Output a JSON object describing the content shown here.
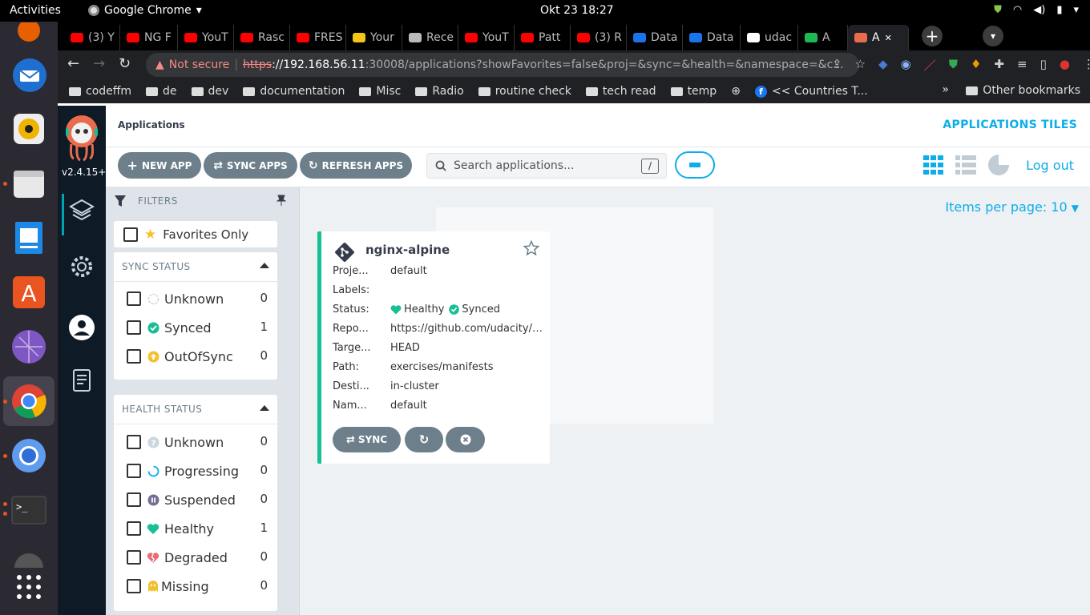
{
  "os": {
    "activities": "Activities",
    "app_name": "Google Chrome",
    "clock": "Okt 23  18:27"
  },
  "browser": {
    "tabs": [
      {
        "label": "(3) Y",
        "color": "#ff0000"
      },
      {
        "label": "NG F",
        "color": "#ff0000"
      },
      {
        "label": "YouT",
        "color": "#ff0000"
      },
      {
        "label": "Rasc",
        "color": "#ff0000"
      },
      {
        "label": "FRES",
        "color": "#ff0000"
      },
      {
        "label": "Your",
        "color": "#f5c518"
      },
      {
        "label": "Rece",
        "color": "#bbbbbb"
      },
      {
        "label": "YouT",
        "color": "#ff0000"
      },
      {
        "label": "Patt",
        "color": "#ff0000"
      },
      {
        "label": "(3) R",
        "color": "#ff0000"
      },
      {
        "label": "Data",
        "color": "#1a73e8"
      },
      {
        "label": "Data",
        "color": "#1a73e8"
      },
      {
        "label": "udac",
        "color": "#ffffff"
      },
      {
        "label": "A",
        "color": "#1db954"
      },
      {
        "label": "A",
        "color": "#e96d4c",
        "active": true
      }
    ],
    "omnibox": {
      "warning": "Not secure",
      "protocol": "https",
      "host": "://192.168.56.11",
      "path": ":30008/applications?showFavorites=false&proj=&sync=&health=&namespace=&c..."
    },
    "bookmarks": [
      "codeffm",
      "de",
      "dev",
      "documentation",
      "Misc",
      "Radio",
      "routine check",
      "tech read",
      "temp"
    ],
    "bookmark_special": "<< Countries T...",
    "other_bookmarks": "Other bookmarks",
    "overflow": "»"
  },
  "argo": {
    "version": "v2.4.15+",
    "breadcrumb": "Applications",
    "page_title": "APPLICATIONS TILES",
    "buttons": {
      "new_app": "NEW APP",
      "sync_apps": "SYNC APPS",
      "refresh_apps": "REFRESH APPS"
    },
    "search_placeholder": "Search applications...",
    "search_shortcut": "/",
    "logout": "Log out",
    "items_per_page": "Items per page: 10",
    "filters": {
      "title": "FILTERS",
      "favorites_only": "Favorites Only",
      "sync_status_title": "SYNC STATUS",
      "sync_status": [
        {
          "label": "Unknown",
          "count": "0"
        },
        {
          "label": "Synced",
          "count": "1"
        },
        {
          "label": "OutOfSync",
          "count": "0"
        }
      ],
      "health_status_title": "HEALTH STATUS",
      "health_status": [
        {
          "label": "Unknown",
          "count": "0"
        },
        {
          "label": "Progressing",
          "count": "0"
        },
        {
          "label": "Suspended",
          "count": "0"
        },
        {
          "label": "Healthy",
          "count": "1"
        },
        {
          "label": "Degraded",
          "count": "0"
        },
        {
          "label": "Missing",
          "count": "0"
        }
      ]
    },
    "app_card": {
      "name": "nginx-alpine",
      "rows": [
        {
          "key": "Proje...",
          "value": "default"
        },
        {
          "key": "Labels:",
          "value": ""
        },
        {
          "key": "Status:",
          "value": ""
        },
        {
          "key": "Repo...",
          "value": "https://github.com/udacity/nd..."
        },
        {
          "key": "Targe...",
          "value": "HEAD"
        },
        {
          "key": "Path:",
          "value": "exercises/manifests"
        },
        {
          "key": "Desti...",
          "value": "in-cluster"
        },
        {
          "key": "Nam...",
          "value": "default"
        }
      ],
      "health": "Healthy",
      "sync": "Synced",
      "sync_button": "SYNC"
    },
    "colors": {
      "accent": "#0dadea",
      "healthy": "#18be94",
      "out_of_sync": "#f4c030",
      "degraded": "#e96d76",
      "suspended": "#766f94",
      "button": "#6d7f8b"
    }
  }
}
